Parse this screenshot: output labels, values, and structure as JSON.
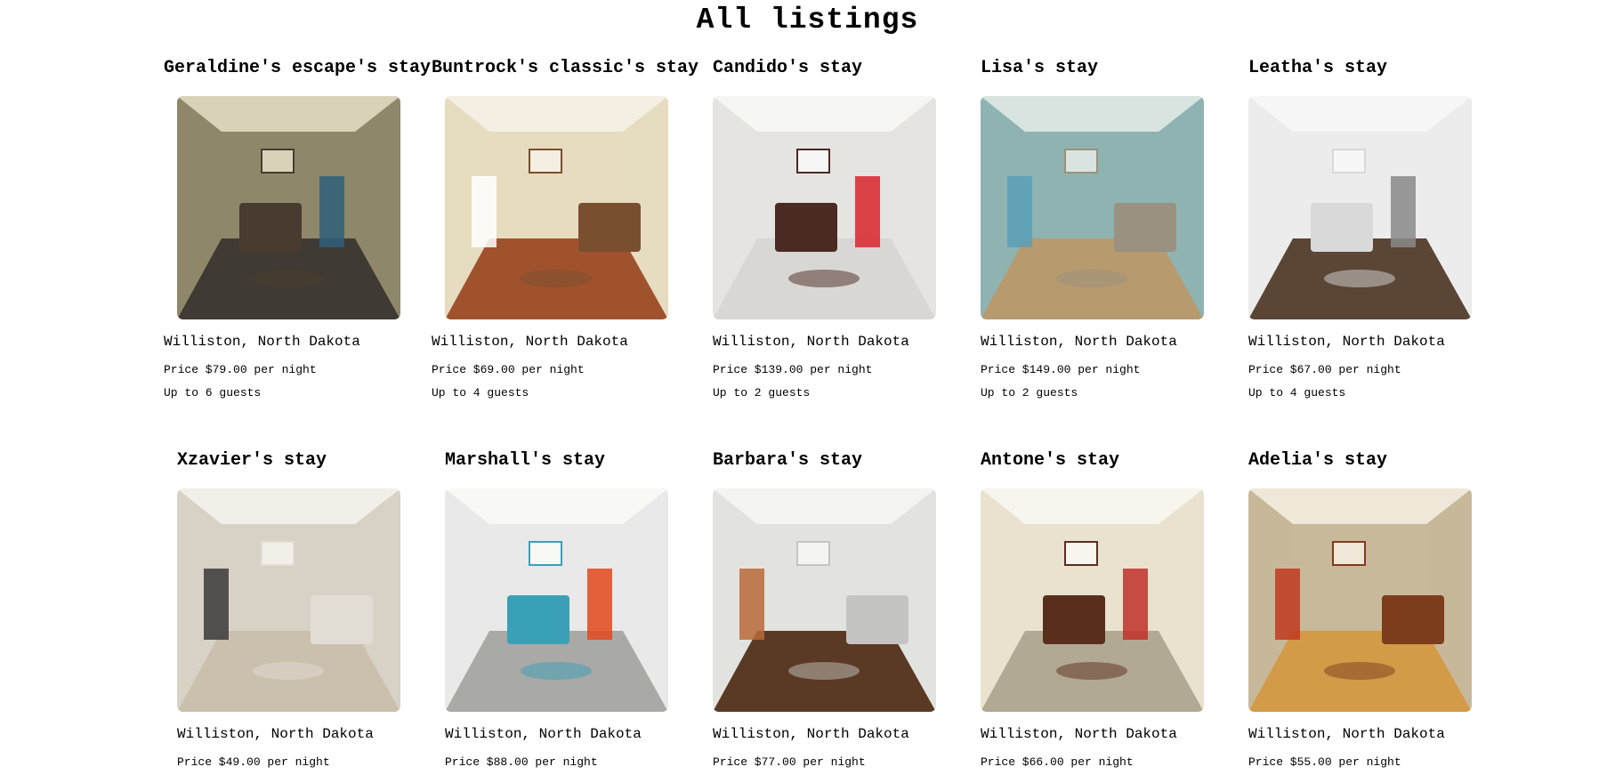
{
  "page": {
    "title": "All listings"
  },
  "listings": [
    {
      "title": "Geraldine's escape's stay",
      "location": "Williston, North Dakota",
      "price": "Price $79.00 per night",
      "guests": "Up to 6 guests"
    },
    {
      "title": "Buntrock's classic's stay",
      "location": "Williston, North Dakota",
      "price": "Price $69.00 per night",
      "guests": "Up to 4 guests"
    },
    {
      "title": "Candido's stay",
      "location": "Williston, North Dakota",
      "price": "Price $139.00 per night",
      "guests": "Up to 2 guests"
    },
    {
      "title": "Lisa's stay",
      "location": "Williston, North Dakota",
      "price": "Price $149.00 per night",
      "guests": "Up to 2 guests"
    },
    {
      "title": "Leatha's stay",
      "location": "Williston, North Dakota",
      "price": "Price $67.00 per night",
      "guests": "Up to 4 guests"
    },
    {
      "title": "Xzavier's stay",
      "location": "Williston, North Dakota",
      "price": "Price $49.00 per night",
      "guests": ""
    },
    {
      "title": "Marshall's stay",
      "location": "Williston, North Dakota",
      "price": "Price $88.00 per night",
      "guests": ""
    },
    {
      "title": "Barbara's stay",
      "location": "Williston, North Dakota",
      "price": "Price $77.00 per night",
      "guests": ""
    },
    {
      "title": "Antone's stay",
      "location": "Williston, North Dakota",
      "price": "Price $66.00 per night",
      "guests": ""
    },
    {
      "title": "Adelia's stay",
      "location": "Williston, North Dakota",
      "price": "Price $55.00 per night",
      "guests": ""
    }
  ],
  "photo_palettes": [
    {
      "wall": "#8f876a",
      "floor": "#3f3a33",
      "accent": "#2f5f7a",
      "furniture": "#4a3b30",
      "light": "#d9d2b8"
    },
    {
      "wall": "#e6dcc0",
      "floor": "#a0522d",
      "accent": "#ffffff",
      "furniture": "#7a4f2e",
      "light": "#f4efe2"
    },
    {
      "wall": "#e5e4e1",
      "floor": "#d9d7d3",
      "accent": "#d8252b",
      "furniture": "#4a2a22",
      "light": "#f6f6f4"
    },
    {
      "wall": "#8fb3b1",
      "floor": "#b79a6e",
      "accent": "#5a9fb8",
      "furniture": "#9a9180",
      "light": "#d8e4e0"
    },
    {
      "wall": "#ececec",
      "floor": "#5b4535",
      "accent": "#8a8a8a",
      "furniture": "#d9d9d9",
      "light": "#f7f7f7"
    },
    {
      "wall": "#d8d2c6",
      "floor": "#cbbfae",
      "accent": "#3a3a3a",
      "furniture": "#e2ddd4",
      "light": "#f2efe8"
    },
    {
      "wall": "#e9e9e9",
      "floor": "#a9a9a6",
      "accent": "#e2481b",
      "furniture": "#3aa0b8",
      "light": "#f8f8f5"
    },
    {
      "wall": "#e2e3de",
      "floor": "#5a3a24",
      "accent": "#b86a3a",
      "furniture": "#c4c4c2",
      "light": "#f4f4f1"
    },
    {
      "wall": "#e8e2cf",
      "floor": "#b2a993",
      "accent": "#c0302a",
      "furniture": "#5a2e1d",
      "light": "#f7f5ee"
    },
    {
      "wall": "#c8b89a",
      "floor": "#d39a48",
      "accent": "#c0381e",
      "furniture": "#7d3c1c",
      "light": "#efe8d8"
    }
  ]
}
